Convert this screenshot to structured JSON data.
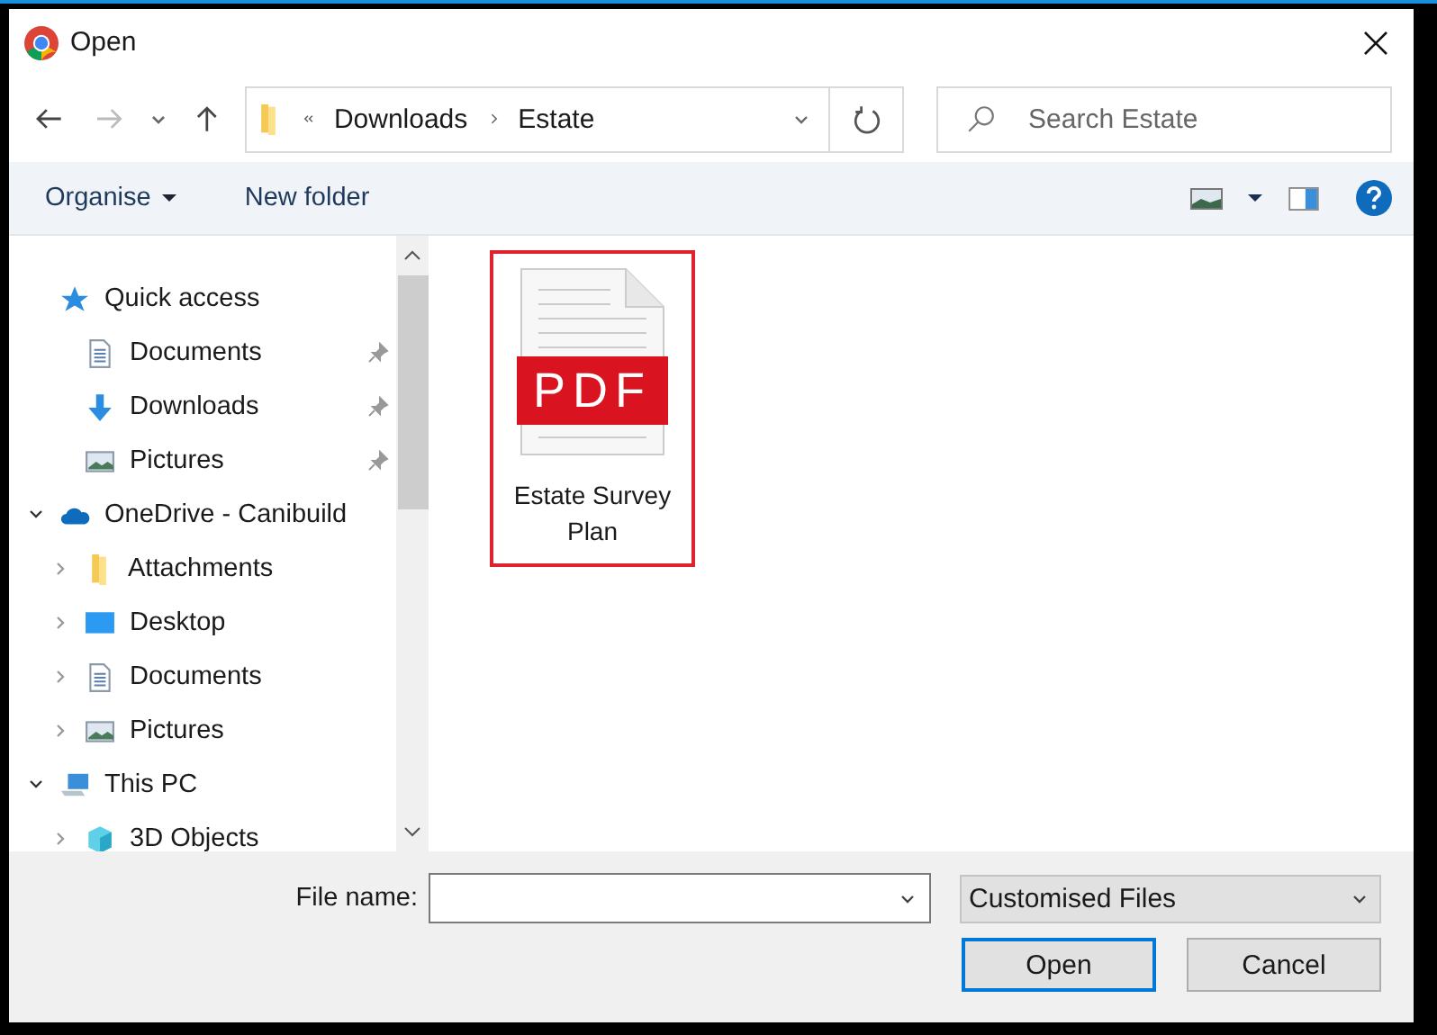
{
  "window": {
    "title": "Open"
  },
  "address_bar": {
    "path": [
      "Downloads",
      "Estate"
    ]
  },
  "search": {
    "placeholder": "Search Estate"
  },
  "toolbar": {
    "buttons": [
      "Organise",
      "New folder"
    ]
  },
  "sidebar": {
    "items": [
      {
        "label": "Quick access",
        "kind": "star",
        "children": [
          {
            "label": "Documents",
            "kind": "document",
            "pinned": true
          },
          {
            "label": "Downloads",
            "kind": "download",
            "pinned": true
          },
          {
            "label": "Pictures",
            "kind": "pictures",
            "pinned": true
          }
        ]
      },
      {
        "label": "OneDrive - Canibuild",
        "kind": "cloud",
        "expanded": true,
        "children": [
          {
            "label": "Attachments",
            "kind": "folder",
            "expanded": false
          },
          {
            "label": "Desktop",
            "kind": "desktop",
            "expanded": false
          },
          {
            "label": "Documents",
            "kind": "document",
            "expanded": false
          },
          {
            "label": "Pictures",
            "kind": "pictures",
            "expanded": false
          }
        ]
      },
      {
        "label": "This PC",
        "kind": "pc",
        "expanded": true,
        "children": [
          {
            "label": "3D Objects",
            "kind": "cube",
            "expanded": false
          }
        ]
      }
    ]
  },
  "files": [
    {
      "name": "Estate Survey Plan",
      "badge": "PDF",
      "selected": true
    }
  ],
  "file_name": {
    "label": "File name:"
  },
  "file_type": {
    "value": "Customised Files"
  },
  "buttons": [
    {
      "label": "Open",
      "default": true
    },
    {
      "label": "Cancel",
      "default": false
    }
  ]
}
